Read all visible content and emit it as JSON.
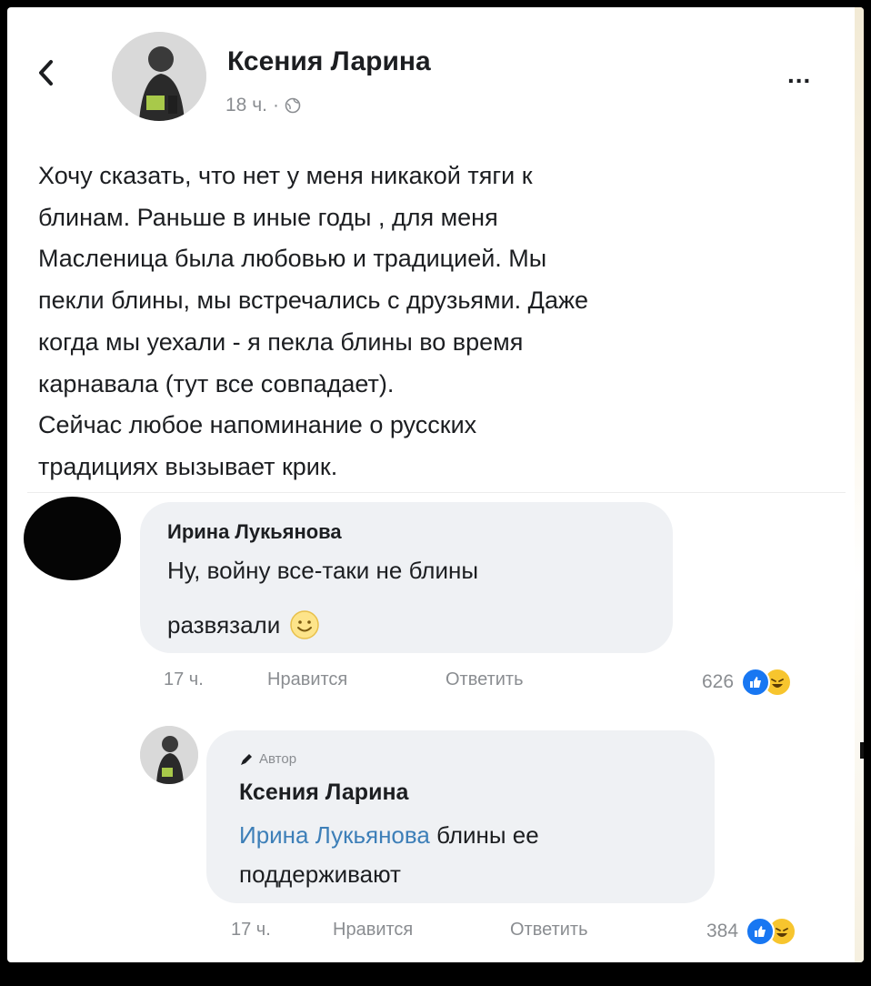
{
  "post": {
    "author": "Ксения Ларина",
    "time": "18 ч.",
    "meta_separator": "·",
    "privacy_icon": "globe-icon",
    "more_label": "...",
    "back_icon": "chevron-left-icon",
    "text_lines": [
      "Хочу сказать, что нет у меня никакой тяги к",
      "блинам. Раньше в иные годы , для меня",
      "Масленица была любовью и традицией.  Мы",
      "пекли блины, мы встречались с друзьями. Даже",
      "когда мы уехали - я пекла блины во время",
      "карнавала (тут все совпадает).",
      "Сейчас любое напоминание о русских",
      "традициях вызывает крик."
    ]
  },
  "comments": [
    {
      "author": "Ирина Лукьянова",
      "line1": "Ну, войну все-таки не блины",
      "line2": "развязали",
      "emoji": "smiley-icon",
      "time": "17 ч.",
      "like_label": "Нравится",
      "reply_label": "Ответить",
      "reaction_count": "626",
      "reaction_icons": [
        "like-icon",
        "haha-icon"
      ]
    },
    {
      "badge": "Автор",
      "badge_icon": "pen-icon",
      "author": "Ксения Ларина",
      "mention": "Ирина Лукьянова",
      "text_after_mention": " блины ее",
      "line2": "поддерживают",
      "time": "17 ч.",
      "like_label": "Нравится",
      "reply_label": "Ответить",
      "reaction_count": "384",
      "reaction_icons": [
        "like-icon",
        "haha-icon"
      ]
    }
  ],
  "colors": {
    "mention": "#3d7fb8",
    "like_blue": "#1877f2",
    "haha_yellow": "#f7c52e",
    "bubble_bg": "#eff1f4",
    "meta_gray": "#8a8d91"
  }
}
